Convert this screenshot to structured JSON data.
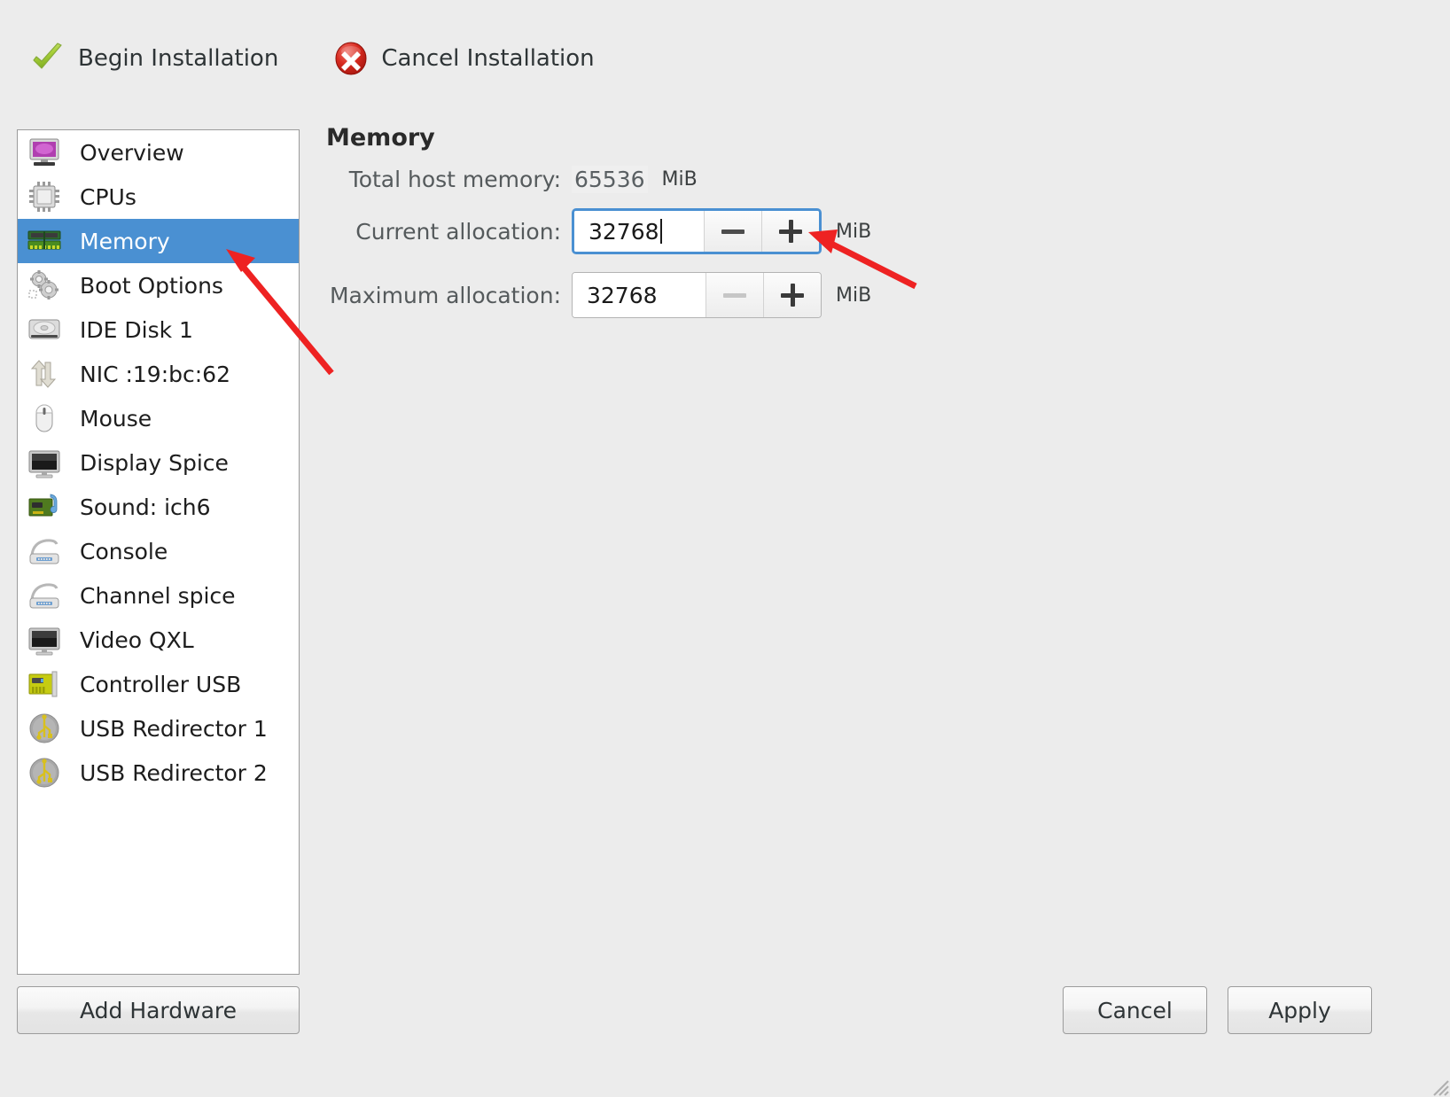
{
  "toolbar": {
    "begin": {
      "label": "Begin Installation",
      "icon": "check-icon"
    },
    "cancel": {
      "label": "Cancel Installation",
      "icon": "cancel-circle-icon"
    }
  },
  "sidebar": {
    "items": [
      {
        "label": "Overview",
        "icon": "monitor-icon",
        "selected": false
      },
      {
        "label": "CPUs",
        "icon": "cpu-chip-icon",
        "selected": false
      },
      {
        "label": "Memory",
        "icon": "memory-module-icon",
        "selected": true
      },
      {
        "label": "Boot Options",
        "icon": "gears-icon",
        "selected": false
      },
      {
        "label": "IDE Disk 1",
        "icon": "harddisk-icon",
        "selected": false
      },
      {
        "label": "NIC :19:bc:62",
        "icon": "network-arrows-icon",
        "selected": false
      },
      {
        "label": "Mouse",
        "icon": "mouse-icon",
        "selected": false
      },
      {
        "label": "Display Spice",
        "icon": "display-icon",
        "selected": false
      },
      {
        "label": "Sound: ich6",
        "icon": "soundcard-icon",
        "selected": false
      },
      {
        "label": "Console",
        "icon": "console-icon",
        "selected": false
      },
      {
        "label": "Channel spice",
        "icon": "console-icon",
        "selected": false
      },
      {
        "label": "Video QXL",
        "icon": "display-icon",
        "selected": false
      },
      {
        "label": "Controller USB",
        "icon": "usb-controller-icon",
        "selected": false
      },
      {
        "label": "USB Redirector 1",
        "icon": "usb-redirect-icon",
        "selected": false
      },
      {
        "label": "USB Redirector 2",
        "icon": "usb-redirect-icon",
        "selected": false
      }
    ],
    "add_hardware_label": "Add Hardware"
  },
  "main": {
    "title": "Memory",
    "total_host_memory": {
      "label": "Total host memory:",
      "value": "65536",
      "unit": "MiB"
    },
    "current_allocation": {
      "label": "Current allocation:",
      "value": "32768",
      "unit": "MiB",
      "focused": true,
      "minus_enabled": true,
      "plus_enabled": true
    },
    "maximum_allocation": {
      "label": "Maximum allocation:",
      "value": "32768",
      "unit": "MiB",
      "focused": false,
      "minus_enabled": false,
      "plus_enabled": true
    }
  },
  "footer": {
    "cancel_label": "Cancel",
    "apply_label": "Apply"
  },
  "colors": {
    "selection_blue": "#4a90d2",
    "focus_ring": "#4a90d2",
    "annotation_red": "#ee2222",
    "window_bg": "#ececec"
  },
  "annotations": [
    {
      "name": "arrow-to-memory-item",
      "from": [
        374,
        421
      ],
      "to": [
        258,
        285
      ]
    },
    {
      "name": "arrow-to-plus-button",
      "from": [
        1033,
        323
      ],
      "to": [
        915,
        262
      ]
    }
  ]
}
